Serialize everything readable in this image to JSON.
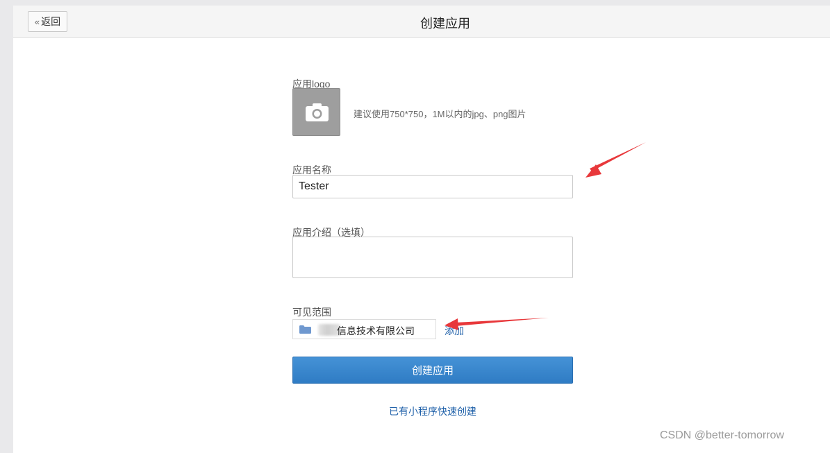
{
  "header": {
    "back_label": "返回",
    "title": "创建应用"
  },
  "form": {
    "logo_label": "应用logo",
    "logo_hint": "建议使用750*750，1M以内的jpg、png图片",
    "name_label": "应用名称",
    "name_value": "Tester",
    "desc_label": "应用介绍（选填）",
    "desc_value": "",
    "scope_label": "可见范围",
    "scope_value": "信息技术有限公司",
    "add_label": "添加",
    "submit_label": "创建应用",
    "quick_create_label": "已有小程序快速创建"
  },
  "watermark": "CSDN @better-tomorrow",
  "colors": {
    "primary": "#3586cc",
    "link": "#1d5fa8",
    "annotation_arrow": "#e8383b"
  },
  "icons": {
    "back": "double-chevron-left-icon",
    "logo_upload": "camera-icon",
    "scope": "folder-icon"
  }
}
